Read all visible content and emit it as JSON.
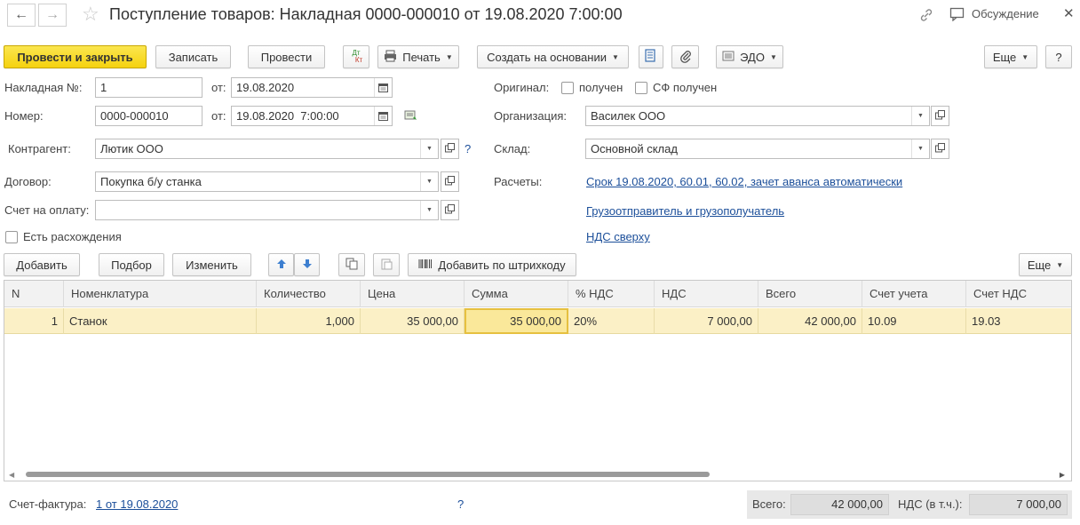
{
  "window": {
    "title": "Поступление товаров: Накладная 0000-000010 от 19.08.2020 7:00:00",
    "discussion_label": "Обсуждение"
  },
  "toolbar": {
    "post_close": "Провести и закрыть",
    "save": "Записать",
    "post": "Провести",
    "dt_kt_top": "Дт",
    "dt_kt_bottom": "Кт",
    "print": "Печать",
    "create_based": "Создать на основании",
    "edo": "ЭДО",
    "more": "Еще",
    "help": "?"
  },
  "form": {
    "invoice_no_label": "Накладная №:",
    "invoice_no_value": "1",
    "from_label": "от:",
    "invoice_date": "19.08.2020",
    "number_label": "Номер:",
    "number_value": "0000-000010",
    "number_datetime": "19.08.2020  7:00:00",
    "counterparty_label": "Контрагент:",
    "counterparty_value": "Лютик ООО",
    "contract_label": "Договор:",
    "contract_value": "Покупка б/у станка",
    "payment_account_label": "Счет на оплату:",
    "payment_account_value": "",
    "discrepancies_label": "Есть расхождения",
    "original_label": "Оригинал:",
    "received_label": "получен",
    "sf_received_label": "СФ получен",
    "org_label": "Организация:",
    "org_value": "Василек ООО",
    "warehouse_label": "Склад:",
    "warehouse_value": "Основной склад",
    "settlements_label": "Расчеты:",
    "settlements_link": "Срок 19.08.2020, 60.01, 60.02, зачет аванса автоматически",
    "shipper_link": "Грузоотправитель и грузополучатель",
    "vat_link": "НДС сверху",
    "help_q": "?"
  },
  "table_toolbar": {
    "add": "Добавить",
    "pick": "Подбор",
    "change": "Изменить",
    "add_barcode": "Добавить по штрихкоду",
    "more": "Еще"
  },
  "table": {
    "columns": [
      "N",
      "Номенклатура",
      "Количество",
      "Цена",
      "Сумма",
      "% НДС",
      "НДС",
      "Всего",
      "Счет учета",
      "Счет НДС"
    ],
    "rows": [
      {
        "n": "1",
        "item": "Станок",
        "qty": "1,000",
        "price": "35 000,00",
        "sum": "35 000,00",
        "vat_rate": "20%",
        "vat": "7 000,00",
        "total": "42 000,00",
        "account": "10.09",
        "vat_account": "19.03"
      }
    ]
  },
  "footer": {
    "invoice_label": "Счет-фактура:",
    "invoice_link": "1 от 19.08.2020",
    "help_q": "?",
    "total_label": "Всего:",
    "total_value": "42 000,00",
    "vat_label": "НДС (в т.ч.):",
    "vat_value": "7 000,00"
  },
  "colors": {
    "primary_button": "#f5d20f",
    "link": "#1c4f9a",
    "selected_row": "#fbf0c6"
  }
}
